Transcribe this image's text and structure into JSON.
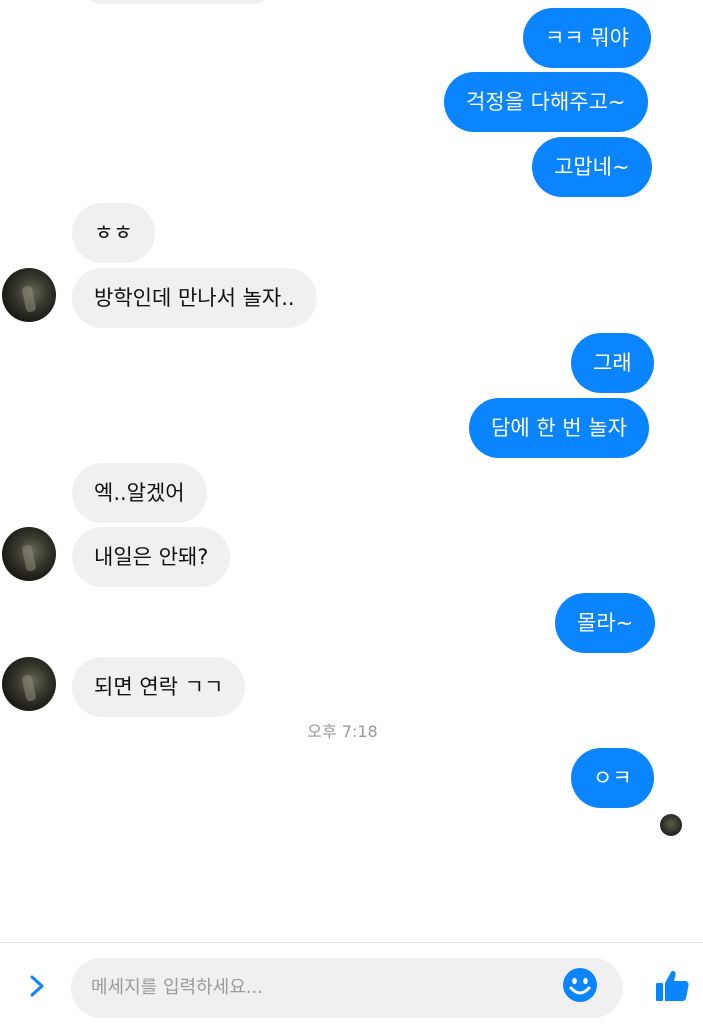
{
  "colors": {
    "outgoing": "#0a84ff",
    "incoming": "#f1f0f0",
    "accent": "#0a84ff"
  },
  "messages": {
    "m1": "ㅋㅋ 뭐야",
    "m2": "걱정을 다해주고~",
    "m3": "고맙네~",
    "m4": "ㅎㅎ",
    "m5": "방학인데 만나서 놀자..",
    "m6": "그래",
    "m7": "담에 한 번 놀자",
    "m8": "엑..알겠어",
    "m9": "내일은 안돼?",
    "m10": "몰라~",
    "m11": "되면 연락 ㄱㄱ",
    "m12": "ㅇㅋ"
  },
  "timestamp": "오후 7:18",
  "composer": {
    "placeholder": "메세지를 입력하세요...",
    "icons": [
      "chevron-right-icon",
      "smiley-icon",
      "thumbs-up-icon"
    ]
  }
}
